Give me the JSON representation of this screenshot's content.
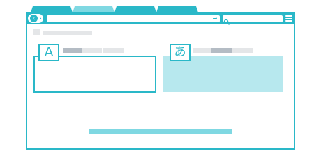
{
  "browser": {
    "tabs": [
      {
        "label": ""
      },
      {
        "label": ""
      },
      {
        "label": ""
      },
      {
        "label": ""
      }
    ],
    "nav_back_icon": "arrow-left-icon",
    "nav_forward_icon": "arrow-right-icon",
    "url": "",
    "go_icon": "arrow-right-icon",
    "search_icon": "search-icon",
    "menu_icon": "hamburger-menu-icon"
  },
  "translator": {
    "source_badge": "A",
    "source_text": "",
    "target_badge": "あ",
    "target_text": ""
  },
  "colors": {
    "accent": "#2ab8c8",
    "accent_light": "#7fd8e2",
    "output_fill": "#b7e8ee",
    "placeholder_gray": "#e4e6e8",
    "placeholder_dark": "#b4bcc4"
  }
}
